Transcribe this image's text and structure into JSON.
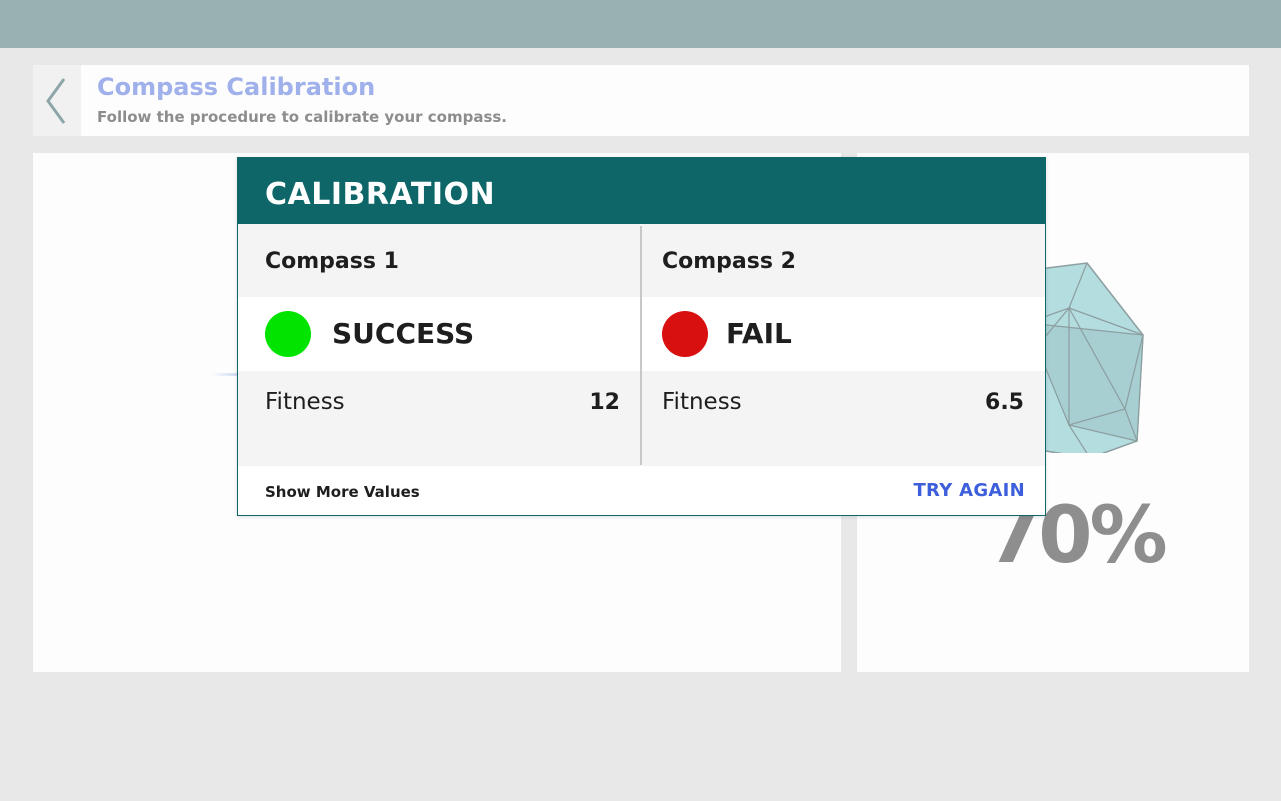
{
  "header": {
    "title": "Compass Calibration",
    "subtitle": "Follow the procedure to calibrate your compass."
  },
  "progress": {
    "percent_text": "70%"
  },
  "dialog": {
    "title": "CALIBRATION",
    "compasses": [
      {
        "name": "Compass 1",
        "status": "SUCCESS",
        "status_color": "#00e400",
        "metric_label": "Fitness",
        "metric_value": "12"
      },
      {
        "name": "Compass 2",
        "status": "FAIL",
        "status_color": "#d91010",
        "metric_label": "Fitness",
        "metric_value": "6.5"
      }
    ],
    "show_more_label": "Show More Values",
    "try_again_label": "TRY AGAIN"
  },
  "colors": {
    "top_bar": "#99b1b3",
    "dialog_header": "#0e6669",
    "title_accent": "#9fb0ea",
    "link_blue": "#3d5fdb"
  },
  "icons": {
    "back": "chevron-left-icon",
    "compass_shape": "polyhedron-icon"
  }
}
